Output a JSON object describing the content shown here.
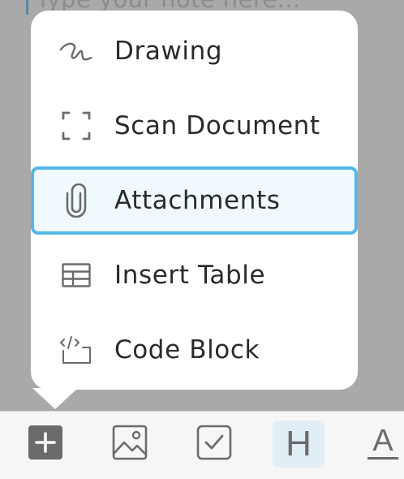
{
  "editor": {
    "placeholder": "Type your note here..."
  },
  "menu": {
    "items": [
      {
        "label": "Drawing",
        "icon": "squiggle-icon"
      },
      {
        "label": "Scan Document",
        "icon": "scan-frame-icon"
      },
      {
        "label": "Attachments",
        "icon": "paperclip-icon",
        "selected": true
      },
      {
        "label": "Insert Table",
        "icon": "table-icon"
      },
      {
        "label": "Code Block",
        "icon": "code-icon"
      }
    ]
  },
  "toolbar": {
    "tools": [
      {
        "name": "add",
        "icon": "plus-square-icon"
      },
      {
        "name": "image",
        "icon": "image-icon"
      },
      {
        "name": "checklist",
        "icon": "checkbox-icon"
      },
      {
        "name": "heading",
        "icon": "heading-icon",
        "glyph": "H",
        "active": true
      },
      {
        "name": "text-style",
        "icon": "text-format-icon",
        "glyph": "A"
      }
    ]
  },
  "colors": {
    "accent": "#54b7e7",
    "selected_bg": "#f0f9fd",
    "backdrop": "#a9a9a9",
    "toolbar_bg": "#f6f6f6",
    "icon_gray": "#6b6b6b"
  }
}
